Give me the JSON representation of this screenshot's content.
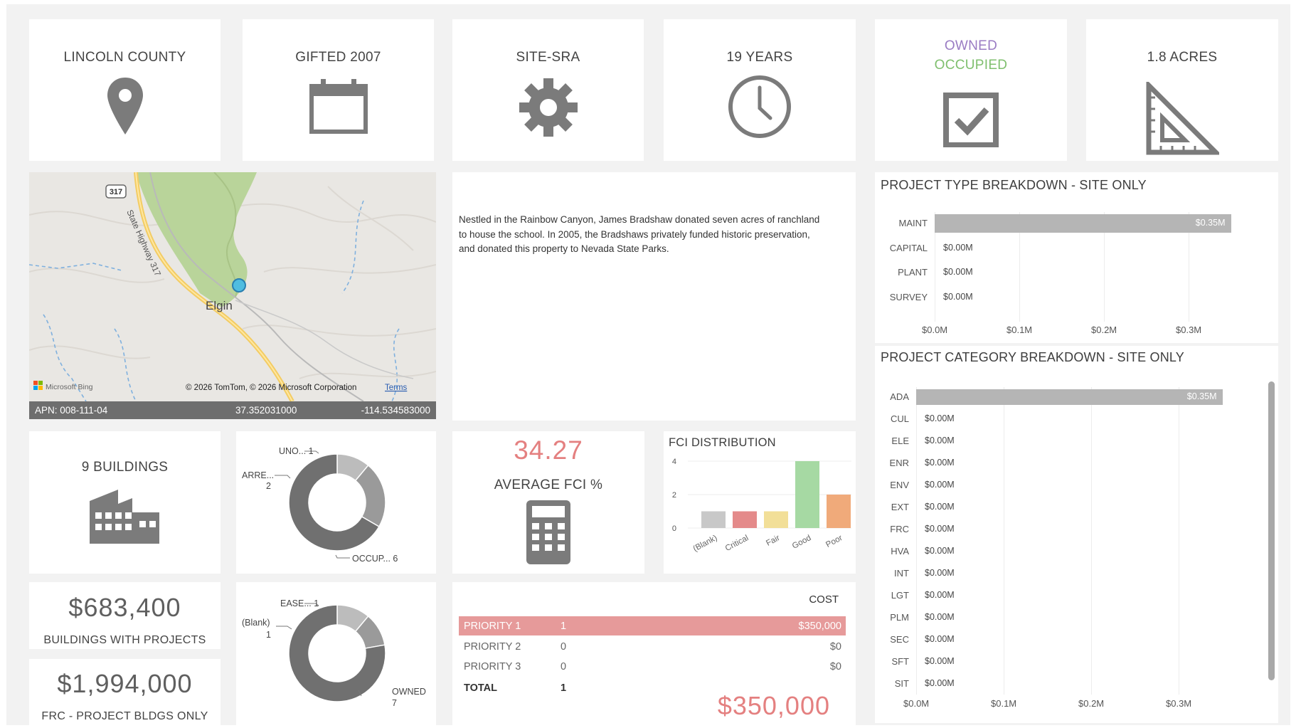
{
  "kpis": [
    {
      "id": "county",
      "title": "LINCOLN COUNTY",
      "icon": "map-pin-icon"
    },
    {
      "id": "gifted",
      "title": "GIFTED 2007",
      "icon": "calendar-icon"
    },
    {
      "id": "site",
      "title": "SITE-SRA",
      "icon": "gear-icon"
    },
    {
      "id": "years",
      "title": "19 YEARS",
      "icon": "clock-icon"
    },
    {
      "id": "occupancy",
      "line1": "OWNED",
      "line2": "OCCUPIED",
      "icon": "checkbox-icon"
    },
    {
      "id": "acres",
      "title": "1.8 ACRES",
      "icon": "set-square-icon"
    }
  ],
  "map": {
    "place": "Elgin",
    "highway_shield": "317",
    "highway_name": "State Highway 317",
    "bing_label": "Microsoft Bing",
    "copyright": "© 2026 TomTom, © 2026 Microsoft Corporation",
    "terms": "Terms",
    "apn": "APN: 008-111-04",
    "lat": "37.352031000",
    "lon": "-114.534583000"
  },
  "description": "Nestled in the Rainbow Canyon, James Bradshaw donated seven acres of ranchland to house the school. In 2005, the Bradshaws privately funded historic preservation, and donated this property to Nevada State Parks.",
  "buildings": {
    "title": "9 BUILDINGS",
    "icon": "buildings-icon"
  },
  "donut1": {
    "labels": [
      {
        "text": "UNO... 1"
      },
      {
        "text": "ARRE..."
      },
      {
        "text": "2"
      },
      {
        "text": "OCCUP... 6"
      }
    ],
    "slices": [
      {
        "name": "UNO...",
        "value": 1,
        "color": "#bcbcbc"
      },
      {
        "name": "ARRE...",
        "value": 2,
        "color": "#9a9a9a"
      },
      {
        "name": "OCCUP...",
        "value": 6,
        "color": "#707070"
      }
    ]
  },
  "donut2": {
    "labels": [
      {
        "text": "EASE... 1"
      },
      {
        "text": "(Blank)"
      },
      {
        "text": "1"
      },
      {
        "text": "OWNED"
      },
      {
        "text": "7"
      }
    ],
    "slices": [
      {
        "name": "EASE...",
        "value": 1,
        "color": "#bcbcbc"
      },
      {
        "name": "(Blank)",
        "value": 1,
        "color": "#9a9a9a"
      },
      {
        "name": "OWNED",
        "value": 7,
        "color": "#707070"
      }
    ]
  },
  "fci": {
    "value": "34.27",
    "label": "AVERAGE FCI %",
    "icon": "calculator-icon",
    "value_color": "#e48080"
  },
  "money1": {
    "value": "$683,400",
    "label": "BUILDINGS WITH PROJECTS"
  },
  "money2": {
    "value": "$1,994,000",
    "label": "FRC - PROJECT BLDGS ONLY"
  },
  "priority_table": {
    "header_cost": "COST",
    "rows": [
      {
        "name": "PRIORITY 1",
        "count": "1",
        "cost": "$350,000",
        "highlight": true
      },
      {
        "name": "PRIORITY 2",
        "count": "0",
        "cost": "$0",
        "highlight": false
      },
      {
        "name": "PRIORITY 3",
        "count": "0",
        "cost": "$0",
        "highlight": false
      }
    ],
    "total_label": "TOTAL",
    "total_count": "1",
    "total_cost": "$350,000",
    "highlight_color": "#e69a9a"
  },
  "chart_data": [
    {
      "type": "bar",
      "title": "FCI DISTRIBUTION",
      "categories": [
        "(Blank)",
        "Critical",
        "Fair",
        "Good",
        "Poor"
      ],
      "values": [
        1,
        1,
        1,
        4,
        2
      ],
      "colors": [
        "#c8c8c8",
        "#e48a8a",
        "#f2df98",
        "#a6d9a3",
        "#f0aa7a"
      ],
      "yticks": [
        "0",
        "2",
        "4"
      ],
      "ylim": [
        0,
        4
      ]
    },
    {
      "type": "bar",
      "orientation": "horizontal",
      "title": "PROJECT TYPE BREAKDOWN - SITE ONLY",
      "categories": [
        "MAINT",
        "CAPITAL",
        "PLANT",
        "SURVEY"
      ],
      "values": [
        0.35,
        0,
        0,
        0
      ],
      "value_labels": [
        "$0.35M",
        "$0.00M",
        "$0.00M",
        "$0.00M"
      ],
      "xticks": [
        "$0.0M",
        "$0.1M",
        "$0.2M",
        "$0.3M"
      ],
      "xlim": [
        0,
        0.4
      ]
    },
    {
      "type": "bar",
      "orientation": "horizontal",
      "title": "PROJECT CATEGORY BREAKDOWN - SITE ONLY",
      "categories": [
        "ADA",
        "CUL",
        "ELE",
        "ENR",
        "ENV",
        "EXT",
        "FRC",
        "HVA",
        "INT",
        "LGT",
        "PLM",
        "SEC",
        "SFT",
        "SIT"
      ],
      "values": [
        0.35,
        0,
        0,
        0,
        0,
        0,
        0,
        0,
        0,
        0,
        0,
        0,
        0,
        0
      ],
      "value_labels": [
        "$0.35M",
        "$0.00M",
        "$0.00M",
        "$0.00M",
        "$0.00M",
        "$0.00M",
        "$0.00M",
        "$0.00M",
        "$0.00M",
        "$0.00M",
        "$0.00M",
        "$0.00M",
        "$0.00M",
        "$0.00M"
      ],
      "xticks": [
        "$0.0M",
        "$0.1M",
        "$0.2M",
        "$0.3M"
      ],
      "xlim": [
        0,
        0.4
      ]
    }
  ]
}
